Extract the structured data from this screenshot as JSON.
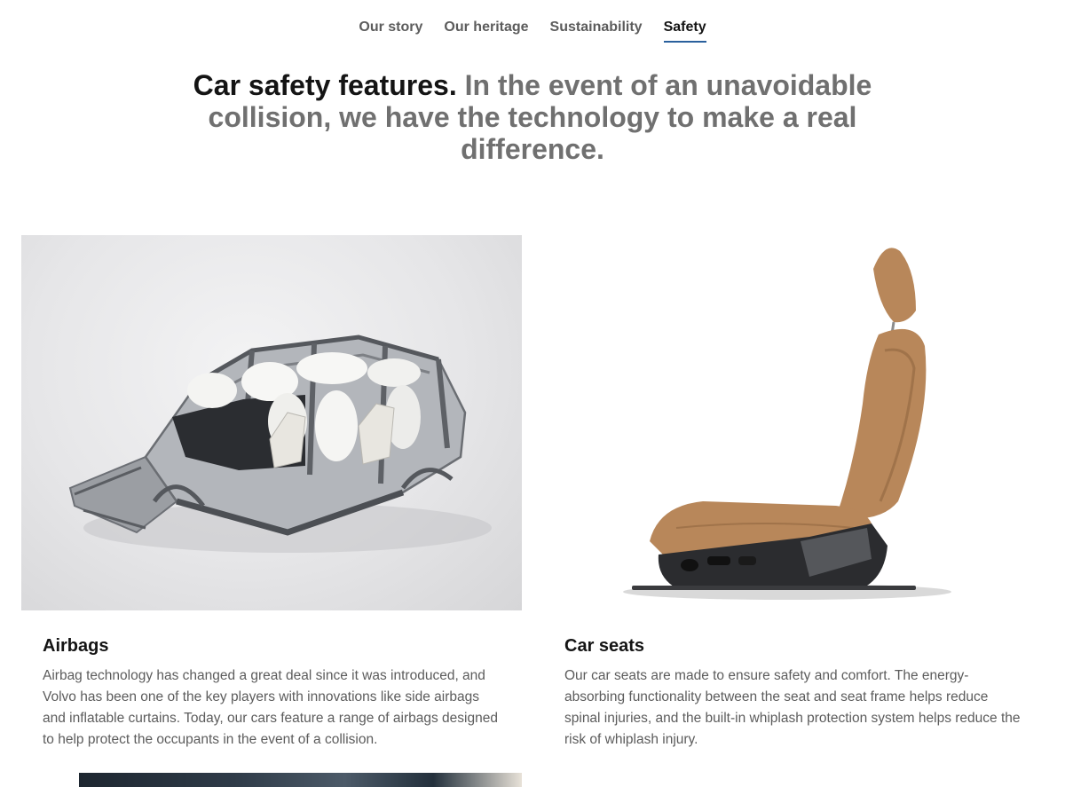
{
  "nav": {
    "items": [
      {
        "label": "Our story",
        "active": false
      },
      {
        "label": "Our heritage",
        "active": false
      },
      {
        "label": "Sustainability",
        "active": false
      },
      {
        "label": "Safety",
        "active": true
      }
    ]
  },
  "headline": {
    "lead": "Car safety features.",
    "rest": "In the event of an unavoidable collision, we have the technology to make a real difference."
  },
  "cards": [
    {
      "title": "Airbags",
      "text": "Airbag technology has changed a great deal since it was introduced, and Volvo has been one of the key players with innovations like side airbags and inflatable curtains. Today, our cars feature a range of airbags designed to help protect the occupants in the event of a collision."
    },
    {
      "title": "Car seats",
      "text": "Our car seats are made to ensure safety and comfort. The energy-absorbing functionality between the seat and seat frame helps reduce spinal injuries, and the built-in whiplash protection system helps reduce the risk of whiplash injury."
    }
  ],
  "colors": {
    "accent_underline": "#2a609d",
    "text_primary": "#141414",
    "text_secondary": "#5c5c5c",
    "headline_muted": "#707070",
    "seat_leather": "#b8875a"
  }
}
